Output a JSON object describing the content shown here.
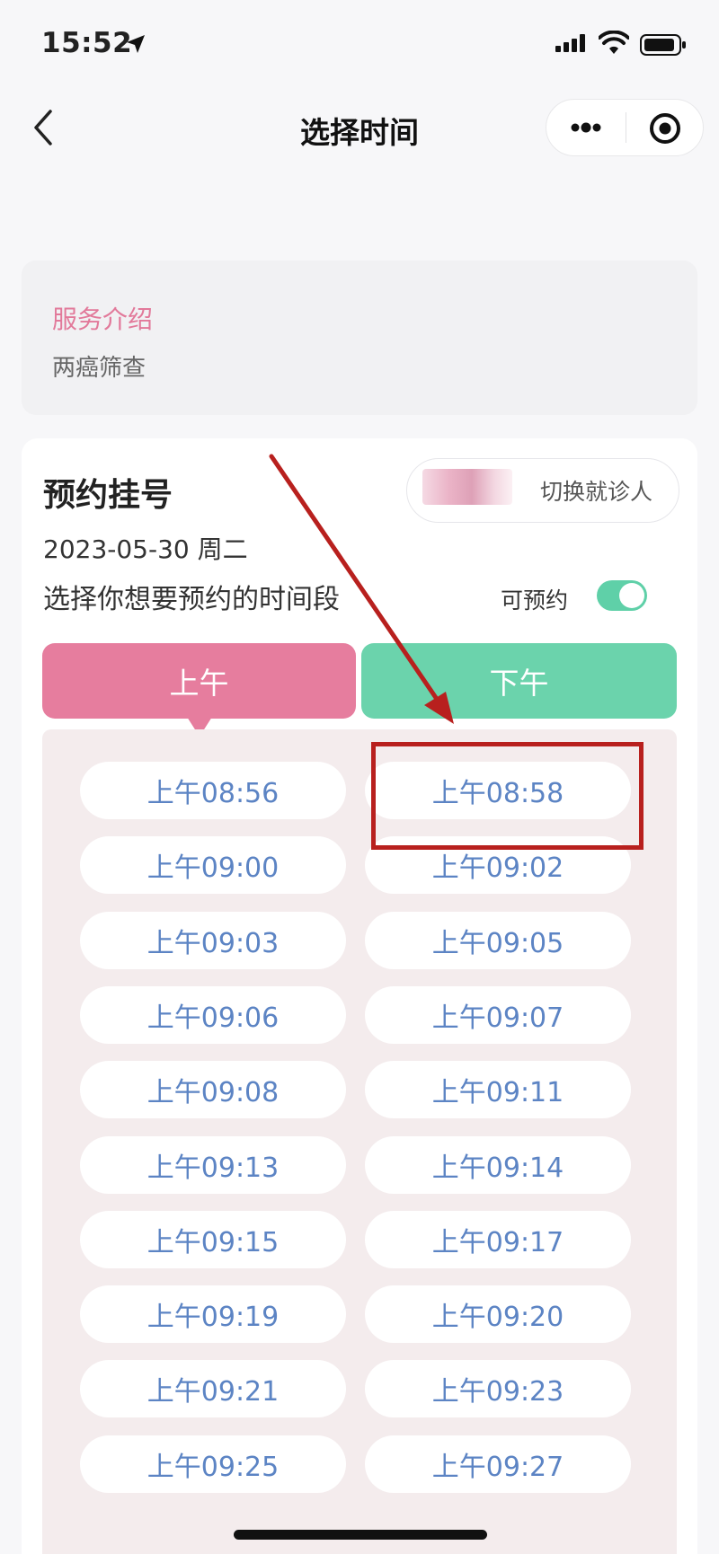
{
  "status_bar": {
    "time": "15:52"
  },
  "nav": {
    "title": "选择时间"
  },
  "service": {
    "title": "服务介绍",
    "description": "两癌筛查"
  },
  "booking": {
    "title": "预约挂号",
    "switch_patient": "切换就诊人",
    "date": "2023-05-30 周二",
    "prompt": "选择你想要预约的时间段",
    "available_label": "可预约",
    "available_on": true,
    "tabs": {
      "am": "上午",
      "pm": "下午"
    },
    "slots": [
      "上午08:56",
      "上午08:58",
      "上午09:00",
      "上午09:02",
      "上午09:03",
      "上午09:05",
      "上午09:06",
      "上午09:07",
      "上午09:08",
      "上午09:11",
      "上午09:13",
      "上午09:14",
      "上午09:15",
      "上午09:17",
      "上午09:19",
      "上午09:20",
      "上午09:21",
      "上午09:23",
      "上午09:25",
      "上午09:27"
    ]
  },
  "colors": {
    "am_tab": "#e67d9e",
    "pm_tab": "#6bd3ac",
    "slot_text": "#5c84c4",
    "accent_pink": "#e2799a",
    "annotation_red": "#b8201e"
  },
  "icons": [
    "location-arrow-icon",
    "signal-icon",
    "wifi-icon",
    "battery-icon",
    "back-icon",
    "more-icon",
    "target-icon"
  ]
}
